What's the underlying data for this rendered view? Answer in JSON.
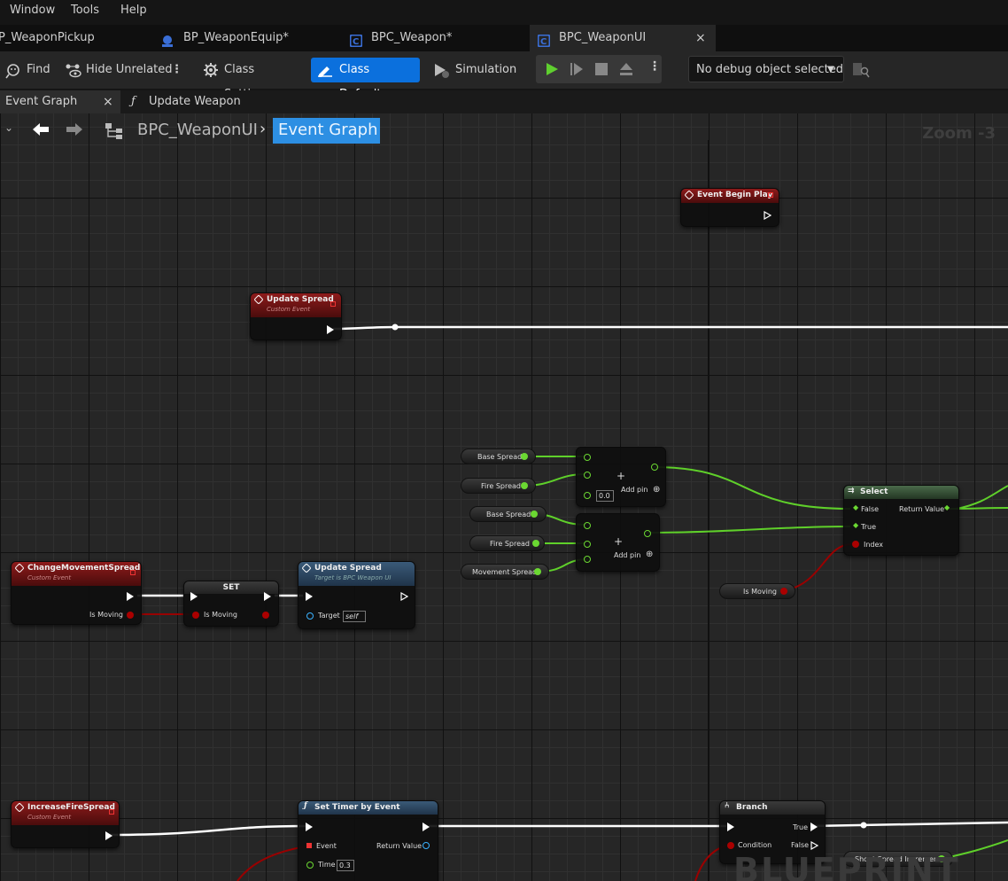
{
  "menu": {
    "items": [
      "Window",
      "Tools",
      "Help"
    ]
  },
  "doc_tabs": [
    {
      "label": "P_WeaponPickup"
    },
    {
      "label": "BP_WeaponEquip*"
    },
    {
      "label": "BPC_Weapon*"
    },
    {
      "label": "BPC_WeaponUI"
    }
  ],
  "doc_tab_close": "×",
  "toolbar": {
    "find": "Find",
    "hide_unrelated": "Hide Unrelated",
    "class_settings": "Class Settings",
    "class_defaults": "Class Defaults",
    "simulation": "Simulation",
    "debug_select": "No debug object selected"
  },
  "graph_tabs": {
    "event_graph": "Event Graph",
    "update_weapon": "Update Weapon",
    "close": "×"
  },
  "breadcrumb": {
    "blueprint": "BPC_WeaponUI",
    "current": "Event Graph",
    "zoom": "Zoom -3"
  },
  "nodes": {
    "event_begin_play": {
      "title": "Event Begin Play"
    },
    "update_spread_event": {
      "title": "Update Spread",
      "subtitle": "Custom Event"
    },
    "change_movement_spread": {
      "title": "ChangeMovementSpread",
      "subtitle": "Custom Event",
      "pin": "Is Moving"
    },
    "set_node": {
      "title": "SET",
      "pin": "Is Moving"
    },
    "update_spread_call": {
      "title": "Update Spread",
      "subtitle": "Target is BPC Weapon UI",
      "target_label": "Target",
      "target_value": "self"
    },
    "add1": {
      "default": "0.0",
      "add_pin": "Add pin"
    },
    "add2": {
      "add_pin": "Add pin"
    },
    "var_base_spread_1": "Base Spread",
    "var_fire_spread_1": "Fire Spread",
    "var_base_spread_2": "Base Spread",
    "var_fire_spread_2": "Fire Spread",
    "var_movement_spread": "Movement Spread",
    "var_is_moving": "Is Moving",
    "select": {
      "title": "Select",
      "false": "False",
      "true": "True",
      "index": "Index",
      "return": "Return Value"
    },
    "increase_fire_spread": {
      "title": "IncreaseFireSpread",
      "subtitle": "Custom Event"
    },
    "set_timer": {
      "title": "Set Timer by Event",
      "event": "Event",
      "time": "Time",
      "time_value": "0.3",
      "return": "Return Value"
    },
    "branch": {
      "title": "Branch",
      "condition": "Condition",
      "true": "True",
      "false": "False"
    },
    "var_shoot_spread_increment": "Shoot Spread Increment"
  },
  "watermark": "BLUEPRINT",
  "colors": {
    "accent": "#0b70dd",
    "exec": "#ffffff",
    "float_pin": "#6bd832",
    "bool_pin": "#a00000",
    "event_header": "#8e1b1b",
    "function_header": "#3a5a78"
  }
}
